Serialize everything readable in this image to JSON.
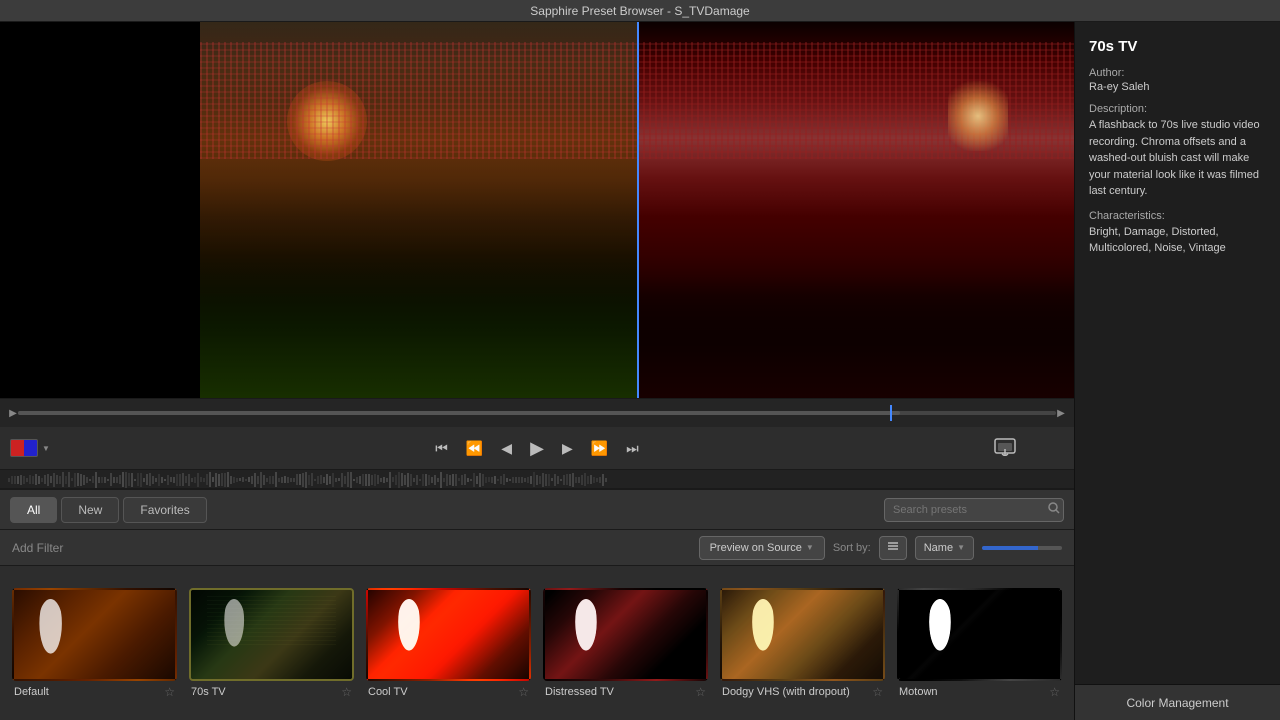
{
  "titlebar": {
    "title": "Sapphire Preset Browser - S_TVDamage"
  },
  "info_panel": {
    "preset_name": "70s TV",
    "author_label": "Author:",
    "author_value": "Ra-ey Saleh",
    "description_label": "Description:",
    "description_text": "A flashback to 70s live studio video recording.  Chroma offsets and a washed-out bluish cast will make your material look like it was filmed last century.",
    "characteristics_label": "Characteristics:",
    "characteristics_text": "Bright, Damage, Distorted, Multicolored, Noise, Vintage"
  },
  "tabs": {
    "all_label": "All",
    "new_label": "New",
    "favorites_label": "Favorites",
    "active": "all"
  },
  "filter_bar": {
    "add_filter_label": "Add Filter",
    "preview_source_label": "Preview on Source",
    "sort_label": "Sort by:",
    "sort_name_label": "Name"
  },
  "search": {
    "placeholder": "Search presets"
  },
  "color_management": {
    "label": "Color Management"
  },
  "presets": [
    {
      "id": "default",
      "name": "Default",
      "thumb_class": "thumb-default",
      "selected": false,
      "starred": false
    },
    {
      "id": "70stv",
      "name": "70s TV",
      "thumb_class": "thumb-70stv",
      "selected": true,
      "starred": false
    },
    {
      "id": "cooltv",
      "name": "Cool TV",
      "thumb_class": "thumb-cooltv",
      "selected": false,
      "starred": false
    },
    {
      "id": "distressed",
      "name": "Distressed TV",
      "thumb_class": "thumb-distressed",
      "selected": false,
      "starred": false
    },
    {
      "id": "dodgy",
      "name": "Dodgy VHS (with dropout)",
      "thumb_class": "thumb-dodgy",
      "selected": false,
      "starred": false
    },
    {
      "id": "motown",
      "name": "Motown",
      "thumb_class": "thumb-motown",
      "selected": false,
      "starred": false
    }
  ],
  "transport": {
    "skip_back": "⏮",
    "back_fast": "⏪",
    "back": "◀",
    "play": "▶",
    "forward": "▶",
    "forward_fast": "⏩",
    "skip_forward": "⏭"
  }
}
